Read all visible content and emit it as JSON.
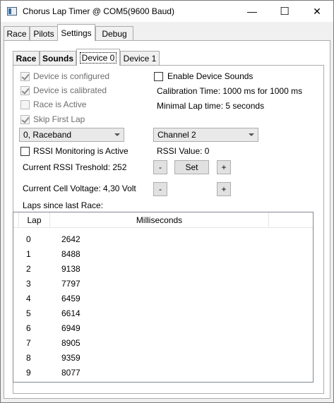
{
  "window": {
    "title": "Chorus Lap Timer @ COM5(9600 Baud)",
    "minimize": "—",
    "maximize": "☐",
    "close": "✕"
  },
  "tabs": [
    {
      "label": "Race",
      "selected": false
    },
    {
      "label": "Pilots",
      "selected": false
    },
    {
      "label": "Settings",
      "selected": true
    },
    {
      "label": "Debug",
      "selected": false
    }
  ],
  "device_tabs": [
    {
      "label": "Race",
      "bold": true,
      "selected": false
    },
    {
      "label": "Sounds",
      "bold": true,
      "selected": false
    },
    {
      "label": "Device 0",
      "bold": false,
      "selected": true
    },
    {
      "label": "Device 1",
      "bold": false,
      "selected": false
    }
  ],
  "checkboxes": {
    "configured": {
      "label": "Device is configured",
      "checked": true,
      "enabled": false
    },
    "calibrated": {
      "label": "Device is calibrated",
      "checked": true,
      "enabled": false
    },
    "race_active": {
      "label": "Race is Active",
      "checked": false,
      "enabled": false
    },
    "skip_first_lap": {
      "label": "Skip First Lap",
      "checked": true,
      "enabled": false
    },
    "enable_sounds": {
      "label": "Enable Device Sounds",
      "checked": false,
      "enabled": true
    },
    "rssi_monitoring": {
      "label": "RSSI Monitoring is Active",
      "checked": false,
      "enabled": true
    }
  },
  "info": {
    "calibration_time": "Calibration Time: 1000 ms for 1000 ms",
    "minimal_lap_time": "Minimal Lap time: 5 seconds",
    "rssi_value": "RSSI Value: 0",
    "rssi_threshold": "Current RSSI Treshold: 252",
    "cell_voltage": "Current Cell Voltage: 4,30 Volt",
    "laps_since": "Laps since last Race:"
  },
  "selects": {
    "band": "0, Raceband",
    "channel": "Channel 2"
  },
  "buttons": {
    "minus": "-",
    "set": "Set",
    "plus": "+"
  },
  "laps_table": {
    "columns": [
      "Lap",
      "Milliseconds"
    ],
    "rows": [
      [
        "0",
        "2642"
      ],
      [
        "1",
        "8488"
      ],
      [
        "2",
        "9138"
      ],
      [
        "3",
        "7797"
      ],
      [
        "4",
        "6459"
      ],
      [
        "5",
        "6614"
      ],
      [
        "6",
        "6949"
      ],
      [
        "7",
        "8905"
      ],
      [
        "8",
        "9359"
      ],
      [
        "9",
        "8077"
      ]
    ]
  }
}
